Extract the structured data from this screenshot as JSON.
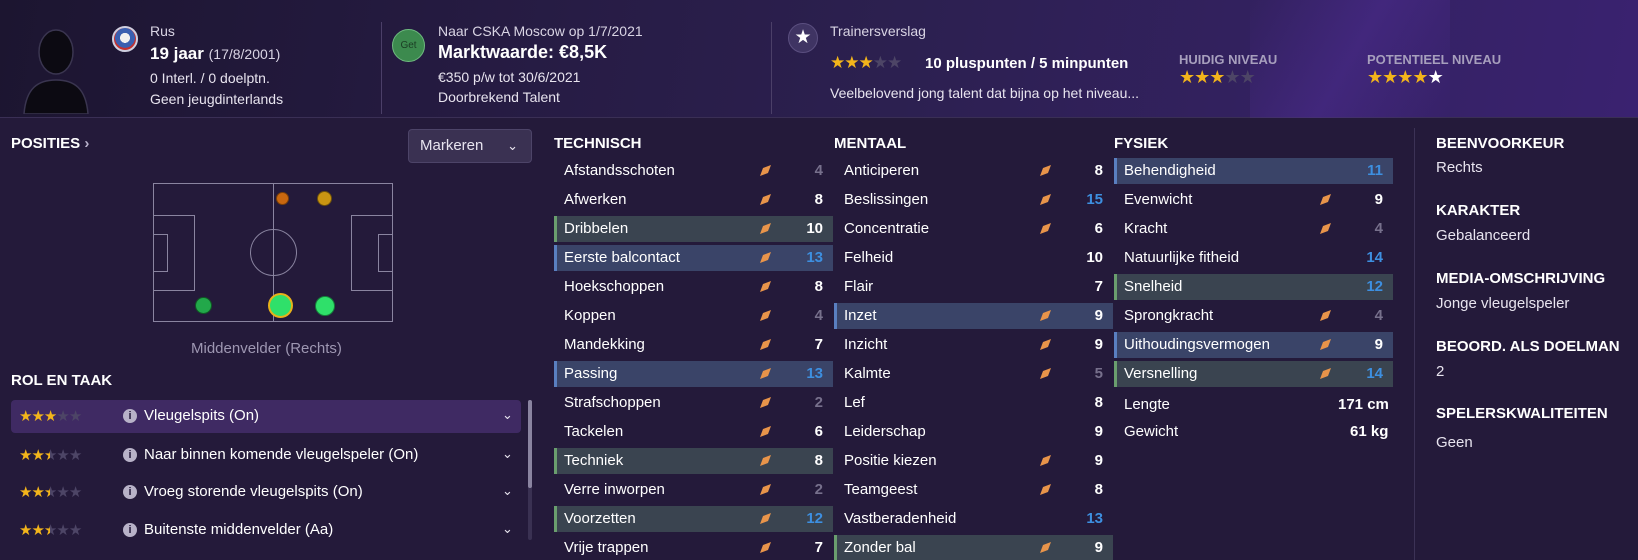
{
  "header": {
    "nationality": "Rus",
    "age": "19 jaar",
    "dob": "(17/8/2001)",
    "internationals": "0 Interl. / 0 doelptn.",
    "youth_internationals": "Geen jeugdinterlands",
    "get_badge": "Get",
    "loan": "Naar CSKA Moscow op 1/7/2021",
    "market_value": "Marktwaarde: €8,5K",
    "wage": "€350 p/w tot 30/6/2021",
    "personality": "Doorbrekend Talent",
    "scout_report_title": "Trainersverslag",
    "scout_stars": 3,
    "plus_minus": "10 pluspunten / 5 minpunten",
    "scout_desc": "Veelbelovend jong talent dat bijna op het niveau...",
    "current_level_label": "HUIDIG NIVEAU",
    "current_level_stars": 3,
    "potential_level_label": "POTENTIEEL NIVEAU",
    "potential_level_stars": 4.5
  },
  "positions": {
    "title": "POSITIES",
    "mark_button": "Markeren",
    "position_label": "Middenvelder (Rechts)"
  },
  "roles": {
    "title": "ROL EN TAAK",
    "items": [
      {
        "stars": 3,
        "name": "Vleugelspits (On)",
        "selected": true
      },
      {
        "stars": 2.5,
        "name": "Naar binnen komende vleugelspeler (On)",
        "selected": false
      },
      {
        "stars": 2.5,
        "name": "Vroeg storende vleugelspits (On)",
        "selected": false
      },
      {
        "stars": 2.5,
        "name": "Buitenste middenvelder (Aa)",
        "selected": false
      }
    ]
  },
  "technical": {
    "title": "TECHNISCH",
    "rows": [
      {
        "name": "Afstandsschoten",
        "value": "4",
        "tone": "grey",
        "hl": ""
      },
      {
        "name": "Afwerken",
        "value": "8",
        "tone": "white",
        "hl": ""
      },
      {
        "name": "Dribbelen",
        "value": "10",
        "tone": "white",
        "hl": "green"
      },
      {
        "name": "Eerste balcontact",
        "value": "13",
        "tone": "blue",
        "hl": "blue"
      },
      {
        "name": "Hoekschoppen",
        "value": "8",
        "tone": "white",
        "hl": ""
      },
      {
        "name": "Koppen",
        "value": "4",
        "tone": "grey",
        "hl": ""
      },
      {
        "name": "Mandekking",
        "value": "7",
        "tone": "white",
        "hl": ""
      },
      {
        "name": "Passing",
        "value": "13",
        "tone": "blue",
        "hl": "blue"
      },
      {
        "name": "Strafschoppen",
        "value": "2",
        "tone": "grey",
        "hl": ""
      },
      {
        "name": "Tackelen",
        "value": "6",
        "tone": "white",
        "hl": ""
      },
      {
        "name": "Techniek",
        "value": "8",
        "tone": "white",
        "hl": "green"
      },
      {
        "name": "Verre inworpen",
        "value": "2",
        "tone": "grey",
        "hl": ""
      },
      {
        "name": "Voorzetten",
        "value": "12",
        "tone": "blue",
        "hl": "green"
      },
      {
        "name": "Vrije trappen",
        "value": "7",
        "tone": "white",
        "hl": ""
      }
    ]
  },
  "mental": {
    "title": "MENTAAL",
    "rows": [
      {
        "name": "Anticiperen",
        "value": "8",
        "tone": "white",
        "hl": "",
        "arrow": true
      },
      {
        "name": "Beslissingen",
        "value": "15",
        "tone": "blue",
        "hl": "",
        "arrow": true
      },
      {
        "name": "Concentratie",
        "value": "6",
        "tone": "white",
        "hl": "",
        "arrow": true
      },
      {
        "name": "Felheid",
        "value": "10",
        "tone": "white",
        "hl": "",
        "arrow": false
      },
      {
        "name": "Flair",
        "value": "7",
        "tone": "white",
        "hl": "",
        "arrow": false
      },
      {
        "name": "Inzet",
        "value": "9",
        "tone": "white",
        "hl": "blue",
        "arrow": true
      },
      {
        "name": "Inzicht",
        "value": "9",
        "tone": "white",
        "hl": "",
        "arrow": true
      },
      {
        "name": "Kalmte",
        "value": "5",
        "tone": "grey",
        "hl": "",
        "arrow": true
      },
      {
        "name": "Lef",
        "value": "8",
        "tone": "white",
        "hl": "",
        "arrow": false
      },
      {
        "name": "Leiderschap",
        "value": "9",
        "tone": "white",
        "hl": "",
        "arrow": false
      },
      {
        "name": "Positie kiezen",
        "value": "9",
        "tone": "white",
        "hl": "",
        "arrow": true
      },
      {
        "name": "Teamgeest",
        "value": "8",
        "tone": "white",
        "hl": "",
        "arrow": true
      },
      {
        "name": "Vastberadenheid",
        "value": "13",
        "tone": "blue",
        "hl": "",
        "arrow": false
      },
      {
        "name": "Zonder bal",
        "value": "9",
        "tone": "white",
        "hl": "green",
        "arrow": true
      }
    ]
  },
  "physical": {
    "title": "FYSIEK",
    "rows": [
      {
        "name": "Behendigheid",
        "value": "11",
        "tone": "blue",
        "hl": "blue",
        "arrow": false
      },
      {
        "name": "Evenwicht",
        "value": "9",
        "tone": "white",
        "hl": "",
        "arrow": true
      },
      {
        "name": "Kracht",
        "value": "4",
        "tone": "grey",
        "hl": "",
        "arrow": true
      },
      {
        "name": "Natuurlijke fitheid",
        "value": "14",
        "tone": "blue",
        "hl": "",
        "arrow": false
      },
      {
        "name": "Snelheid",
        "value": "12",
        "tone": "blue",
        "hl": "green",
        "arrow": false
      },
      {
        "name": "Sprongkracht",
        "value": "4",
        "tone": "grey",
        "hl": "",
        "arrow": true
      },
      {
        "name": "Uithoudingsvermogen",
        "value": "9",
        "tone": "white",
        "hl": "blue",
        "arrow": true
      },
      {
        "name": "Versnelling",
        "value": "14",
        "tone": "blue",
        "hl": "green",
        "arrow": true
      }
    ],
    "height_label": "Lengte",
    "height_value": "171 cm",
    "weight_label": "Gewicht",
    "weight_value": "61 kg"
  },
  "info": {
    "foot_title": "BEENVOORKEUR",
    "foot_value": "Rechts",
    "char_title": "KARAKTER",
    "char_value": "Gebalanceerd",
    "media_title": "MEDIA-OMSCHRIJVING",
    "media_value": "Jonge vleugelspeler",
    "gk_title": "BEOORD. ALS DOELMAN",
    "gk_value": "2",
    "traits_title": "SPELERSKWALITEITEN",
    "traits_value": "Geen"
  },
  "colors": {
    "star": "#f3b51b",
    "blue_value": "#3d8fe0",
    "arrow": "#e8944a",
    "green_edge": "#6a9e6e",
    "blue_edge": "#5a7fc0"
  }
}
